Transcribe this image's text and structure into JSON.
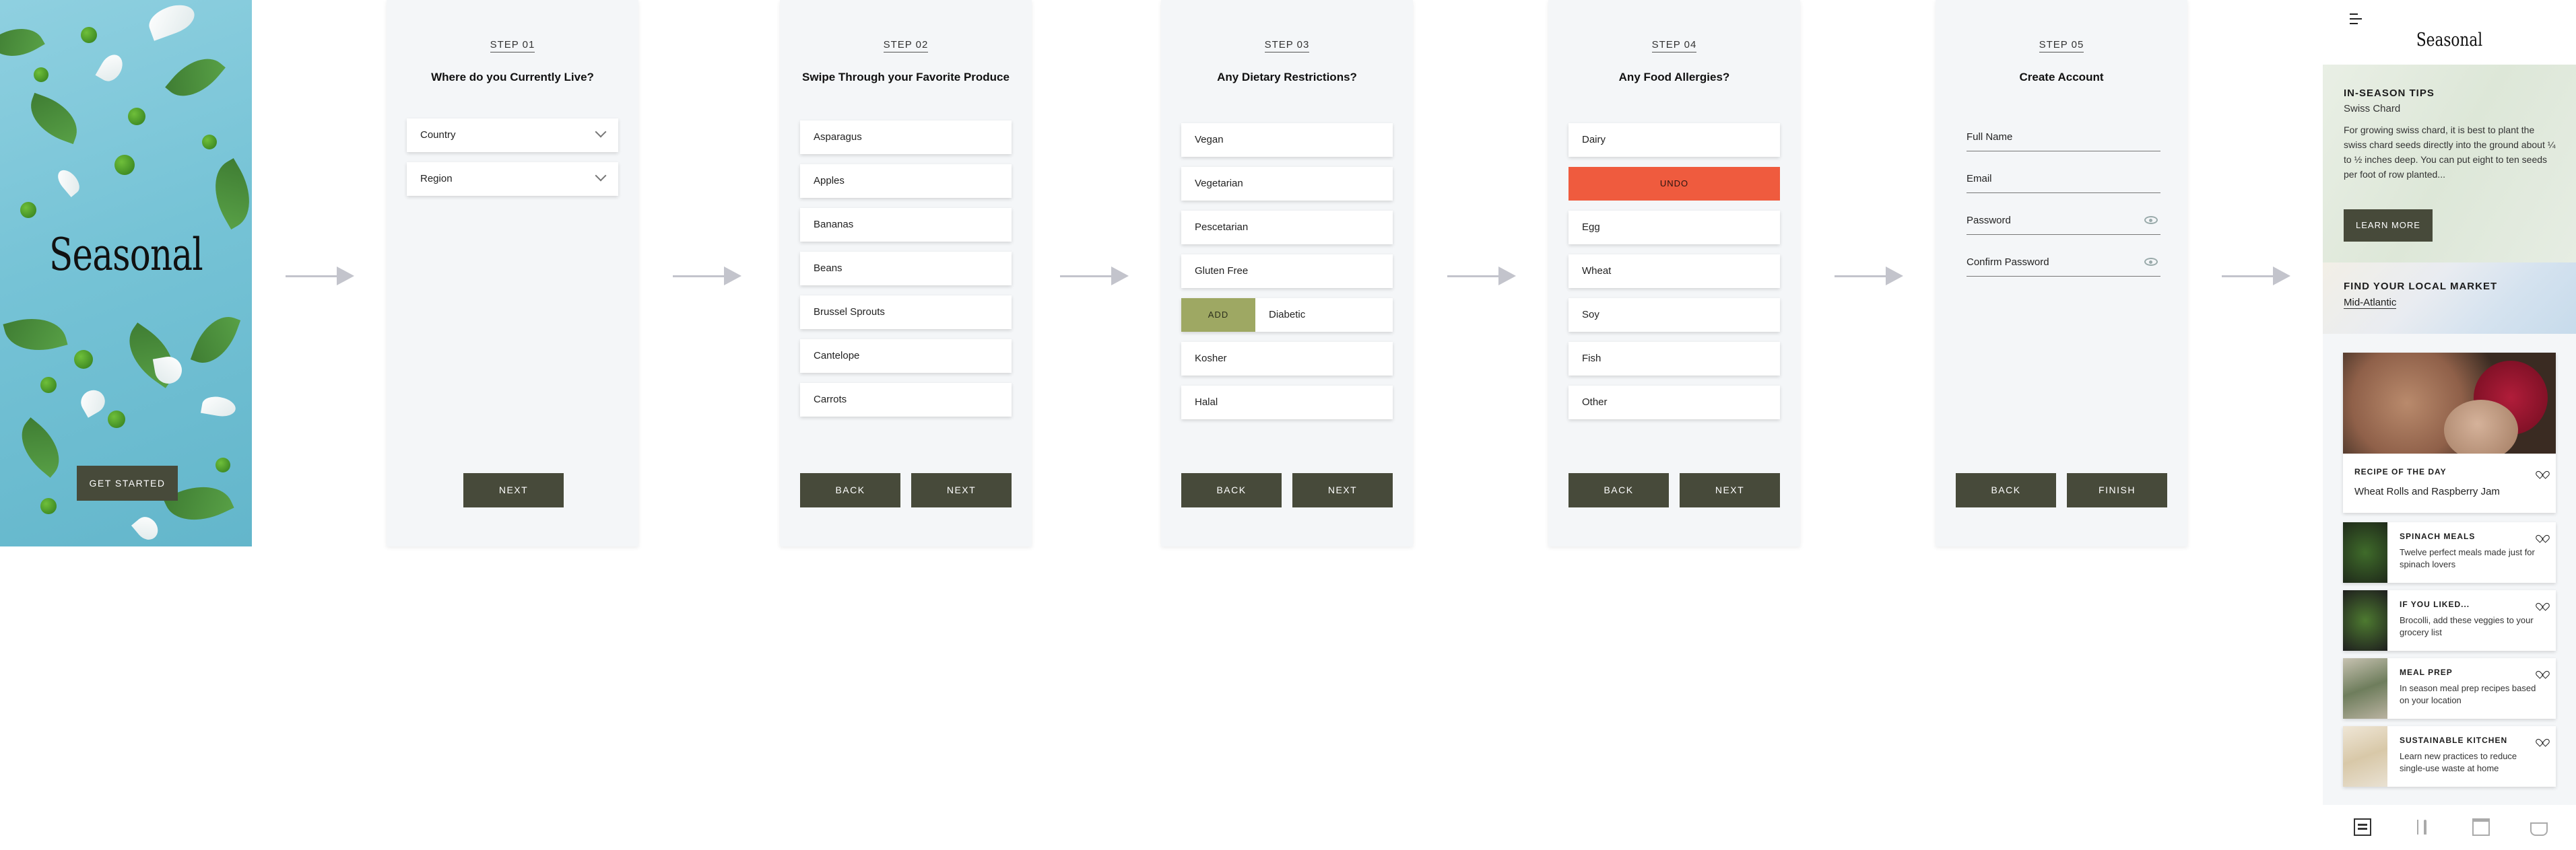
{
  "splash": {
    "logo": "Seasonal",
    "get_started_label": "GET STARTED"
  },
  "steps": [
    {
      "step_label": "STEP 01",
      "title": "Where do you Currently Live?",
      "dropdowns": [
        "Country",
        "Region"
      ],
      "buttons": [
        "NEXT"
      ]
    },
    {
      "step_label": "STEP 02",
      "title": "Swipe Through your Favorite Produce",
      "items": [
        "Asparagus",
        "Apples",
        "Bananas",
        "Beans",
        "Brussel Sprouts",
        "Cantelope",
        "Carrots"
      ],
      "buttons": [
        "BACK",
        "NEXT"
      ]
    },
    {
      "step_label": "STEP 03",
      "title": "Any Dietary Restrictions?",
      "items": [
        "Vegan",
        "Vegetarian",
        "Pescetarian",
        "Gluten Free",
        "Diabetic",
        "Kosher",
        "Halal"
      ],
      "swipe_action": "ADD",
      "buttons": [
        "BACK",
        "NEXT"
      ]
    },
    {
      "step_label": "STEP 04",
      "title": "Any Food Allergies?",
      "items": [
        "Dairy",
        "Egg",
        "Wheat",
        "Soy",
        "Fish",
        "Other"
      ],
      "undo_label": "UNDO",
      "buttons": [
        "BACK",
        "NEXT"
      ]
    },
    {
      "step_label": "STEP 05",
      "title": "Create Account",
      "fields": [
        "Full Name",
        "Email",
        "Password",
        "Confirm Password"
      ],
      "buttons": [
        "BACK",
        "FINISH"
      ]
    }
  ],
  "home": {
    "logo": "Seasonal",
    "tips": {
      "title": "IN-SEASON TIPS",
      "subtitle": "Swiss Chard",
      "body": "For growing swiss chard, it is best to plant the swiss chard seeds directly into the ground about ¼ to ½ inches deep. You can put eight to ten seeds per foot of row planted...",
      "button": "LEARN MORE"
    },
    "market": {
      "title": "FIND YOUR LOCAL MARKET",
      "region": "Mid-Atlantic"
    },
    "recipe_of_day": {
      "label": "RECIPE OF THE DAY",
      "name": "Wheat Rolls and Raspberry Jam"
    },
    "cards": [
      {
        "title": "SPINACH MEALS",
        "desc": "Twelve perfect meals made just for spinach lovers"
      },
      {
        "title": "IF YOU LIKED...",
        "desc": "Brocolli, add these veggies to your grocery list"
      },
      {
        "title": "MEAL PREP",
        "desc": "In season meal prep recipes based on your location"
      },
      {
        "title": "SUSTAINABLE KITCHEN",
        "desc": "Learn new practices to reduce single-use waste at home"
      }
    ],
    "tabs": [
      "home-icon",
      "utensils-icon",
      "calendar-icon",
      "basket-icon"
    ]
  },
  "colors": {
    "button": "#474a3a",
    "undo": "#ef5b3e",
    "add": "#9ea863",
    "panel": "#f4f6f8",
    "arrow": "#c3c4cc"
  }
}
